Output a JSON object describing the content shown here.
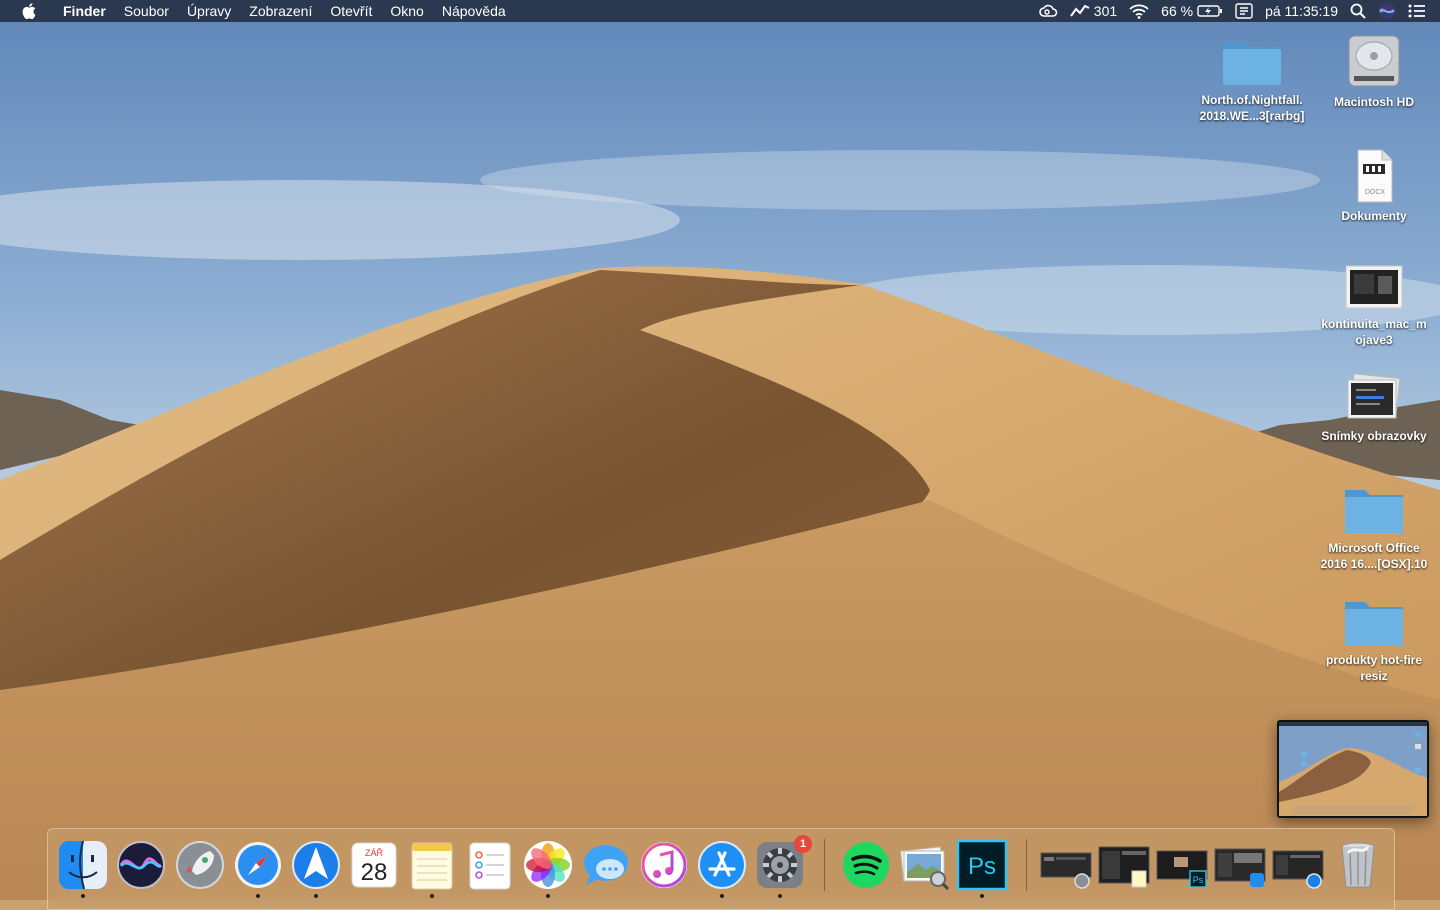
{
  "menubar": {
    "app_name": "Finder",
    "menus": [
      "Soubor",
      "Úpravy",
      "Zobrazení",
      "Otevřít",
      "Okno",
      "Nápověda"
    ],
    "status": {
      "activity_value": "301",
      "battery_percent": "66 %",
      "clock": "pá 11:35:19"
    }
  },
  "desktop": {
    "items": [
      {
        "label": "North.of.Nightfall.\n2018.WE...3[rarbg]",
        "icon": "folder-icon"
      },
      {
        "label": "Macintosh HD",
        "icon": "hard-drive-icon"
      },
      {
        "label": "Dokumenty",
        "icon": "docx-document-icon"
      },
      {
        "label": "kontinuita_mac_m\nojave3",
        "icon": "screenshot-file-icon"
      },
      {
        "label": "Snímky obrazovky",
        "icon": "screenshots-stack-icon"
      },
      {
        "label": "Microsoft Office\n2016 16....[OSX].10",
        "icon": "folder-icon"
      },
      {
        "label": "produkty hot-fire\nresiz",
        "icon": "folder-icon"
      }
    ]
  },
  "dock": {
    "apps": [
      {
        "name": "finder-icon",
        "running": true
      },
      {
        "name": "siri-icon",
        "running": false
      },
      {
        "name": "launchpad-icon",
        "running": false
      },
      {
        "name": "safari-icon",
        "running": true
      },
      {
        "name": "spark-mail-icon",
        "running": true
      },
      {
        "name": "calendar-icon",
        "running": false,
        "month": "ZÁŘ",
        "day": "28"
      },
      {
        "name": "notes-icon",
        "running": true
      },
      {
        "name": "reminders-icon",
        "running": false
      },
      {
        "name": "photos-icon",
        "running": true
      },
      {
        "name": "messages-icon",
        "running": false
      },
      {
        "name": "itunes-icon",
        "running": false
      },
      {
        "name": "app-store-icon",
        "running": true
      },
      {
        "name": "system-preferences-icon",
        "running": true,
        "badge": "1"
      },
      {
        "name": "spotify-icon",
        "running": false
      },
      {
        "name": "preview-icon",
        "running": false
      },
      {
        "name": "photoshop-icon",
        "running": true,
        "label": "Ps"
      }
    ],
    "photoshop_minimized_label": "Ps"
  },
  "colors": {
    "menubar_bg": "#263246",
    "folder": "#63a8d8",
    "badge": "#e8473b"
  }
}
